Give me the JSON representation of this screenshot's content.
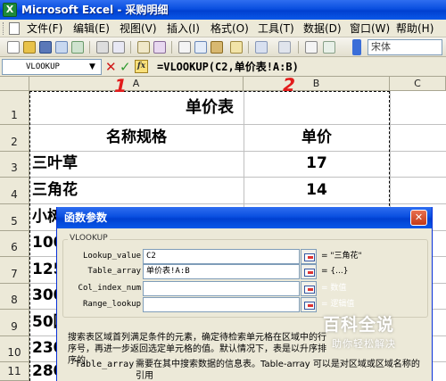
{
  "window": {
    "title": "Microsoft Excel - 采购明细",
    "app_icon": "excel-icon"
  },
  "menu": [
    "文件(F)",
    "编辑(E)",
    "视图(V)",
    "插入(I)",
    "格式(O)",
    "工具(T)",
    "数据(D)",
    "窗口(W)",
    "帮助(H)"
  ],
  "toolbar": {
    "font_name": "宋体"
  },
  "formula_bar": {
    "name_box": "VLOOKUP",
    "name_box_arrow": "▼",
    "cancel": "✕",
    "enter": "✓",
    "fx": "fx",
    "formula": "=VLOOKUP(C2,单价表!A:B)"
  },
  "sheet": {
    "columns": [
      "A",
      "B",
      "C"
    ],
    "rows": [
      "1",
      "2",
      "3",
      "4",
      "5",
      "6",
      "7",
      "8",
      "9",
      "10",
      "11"
    ],
    "cells": {
      "title": "单价表",
      "header_a": "名称规格",
      "header_b": "单价",
      "a3": "三叶草",
      "b3": "17",
      "a4": "三角花",
      "b4": "14",
      "a5": "小树",
      "a6": "100",
      "a7": "125",
      "a8": "300",
      "a9": "50圆",
      "a10": "230",
      "a11": "280"
    }
  },
  "annotations": {
    "mark_1": "1",
    "mark_2": "2",
    "color": "#e21b1b"
  },
  "dialog": {
    "title": "函数参数",
    "close": "✕",
    "function_name": "VLOOKUP",
    "args": [
      {
        "label": "Lookup_value",
        "value": "C2",
        "result": "= \"三角花\"",
        "faded": false
      },
      {
        "label": "Table_array",
        "value": "单价表!A:B",
        "result": "= {...}",
        "faded": false
      },
      {
        "label": "Col_index_num",
        "value": "",
        "result": "= 数值",
        "faded": true
      },
      {
        "label": "Range_lookup",
        "value": "",
        "result": "= 逻辑值",
        "faded": true
      }
    ],
    "description": "搜索表区域首列满足条件的元素，确定待检索单元格在区域中的行序号，再进一步返回选定单元格的值。默认情况下，表是以升序排序的",
    "param_name": "Table_array",
    "param_desc": "需要在其中搜索数据的信息表。Table-array 可以是对区域或区域名称的引用"
  },
  "watermark": {
    "title": "百科全说",
    "subtitle": "助你轻松解决"
  }
}
